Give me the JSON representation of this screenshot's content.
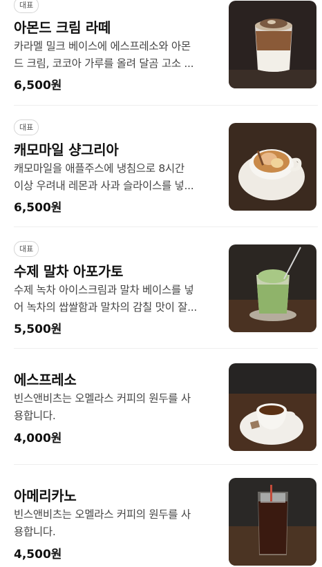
{
  "menu": {
    "items": [
      {
        "badge": "대표",
        "name": "아몬드 크림 라떼",
        "desc_line1": "카라멜 밀크 베이스에 에스프레소와 아몬",
        "desc_line2": "드 크림, 코코아 가루를 올려 달곰 고소 ...",
        "price": "6,500원",
        "image_icon": "almond-cream-latte-photo"
      },
      {
        "badge": "대표",
        "name": "캐모마일 샹그리아",
        "desc_line1": "캐모마일을 애플주스에 냉침으로 8시간",
        "desc_line2": "이상 우려내 레몬과 사과 슬라이스를 넣...",
        "price": "6,500원",
        "image_icon": "chamomile-sangria-photo"
      },
      {
        "badge": "대표",
        "name": "수제 말차 아포가토",
        "desc_line1": "수제 녹차 아이스크림과 말차 베이스를 넣",
        "desc_line2": "어 녹차의 쌉쌀함과 말차의 감칠 맛이 잘...",
        "price": "5,500원",
        "image_icon": "matcha-affogato-photo"
      },
      {
        "badge": "",
        "name": "에스프레소",
        "desc_line1": "빈스앤비츠는 오멜라스 커피의 원두를 사",
        "desc_line2": "용합니다.",
        "price": "4,000원",
        "image_icon": "espresso-photo"
      },
      {
        "badge": "",
        "name": "아메리카노",
        "desc_line1": "빈스앤비츠는 오멜라스 커피의 원두를 사",
        "desc_line2": "용합니다.",
        "price": "4,500원",
        "image_icon": "americano-photo"
      }
    ]
  },
  "colors": {
    "background": "#ffffff",
    "title": "#111111",
    "description": "#444444",
    "badge_border": "#d5d5d5",
    "separator": "#eeeeee"
  }
}
